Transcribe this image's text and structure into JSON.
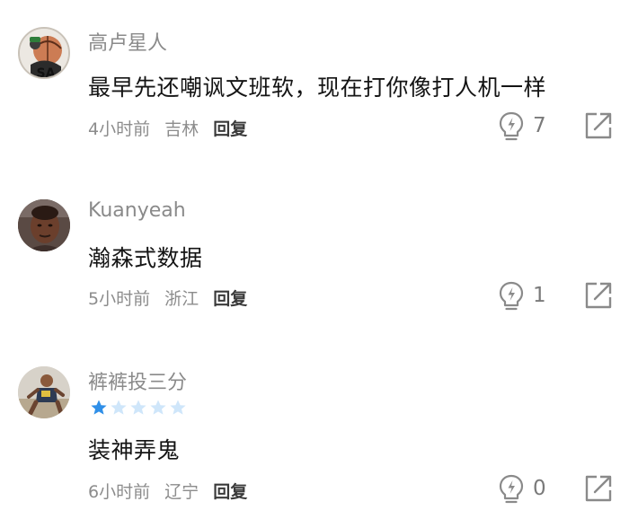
{
  "comments": [
    {
      "username": "高卢星人",
      "text": "最早先还嘲讽文班软，现在打你像打人机一样",
      "time": "4小时前",
      "location": "吉林",
      "reply_label": "回复",
      "likes": "7",
      "avatar_text": "SA",
      "avatar_icon": "basketball-player-avatar"
    },
    {
      "username": "Kuanyeah",
      "text": "瀚森式数据",
      "time": "5小时前",
      "location": "浙江",
      "reply_label": "回复",
      "likes": "1",
      "avatar_icon": "player-portrait-avatar"
    },
    {
      "username": "裤裤投三分",
      "rating": 1,
      "rating_max": 5,
      "text": "装神弄鬼",
      "time": "6小时前",
      "location": "辽宁",
      "reply_label": "回复",
      "likes": "0",
      "avatar_icon": "player-action-avatar"
    }
  ],
  "icons": {
    "like": "lightbulb-lightning-icon",
    "share": "share-external-icon",
    "star": "star-icon"
  },
  "colors": {
    "star_active": "#2f8fe8",
    "star_inactive": "#cfe6fa",
    "meta_text": "#8c8c8c",
    "username_text": "#8a8a8a",
    "body_text": "#141414",
    "icon_gray": "#8a8a8a"
  }
}
